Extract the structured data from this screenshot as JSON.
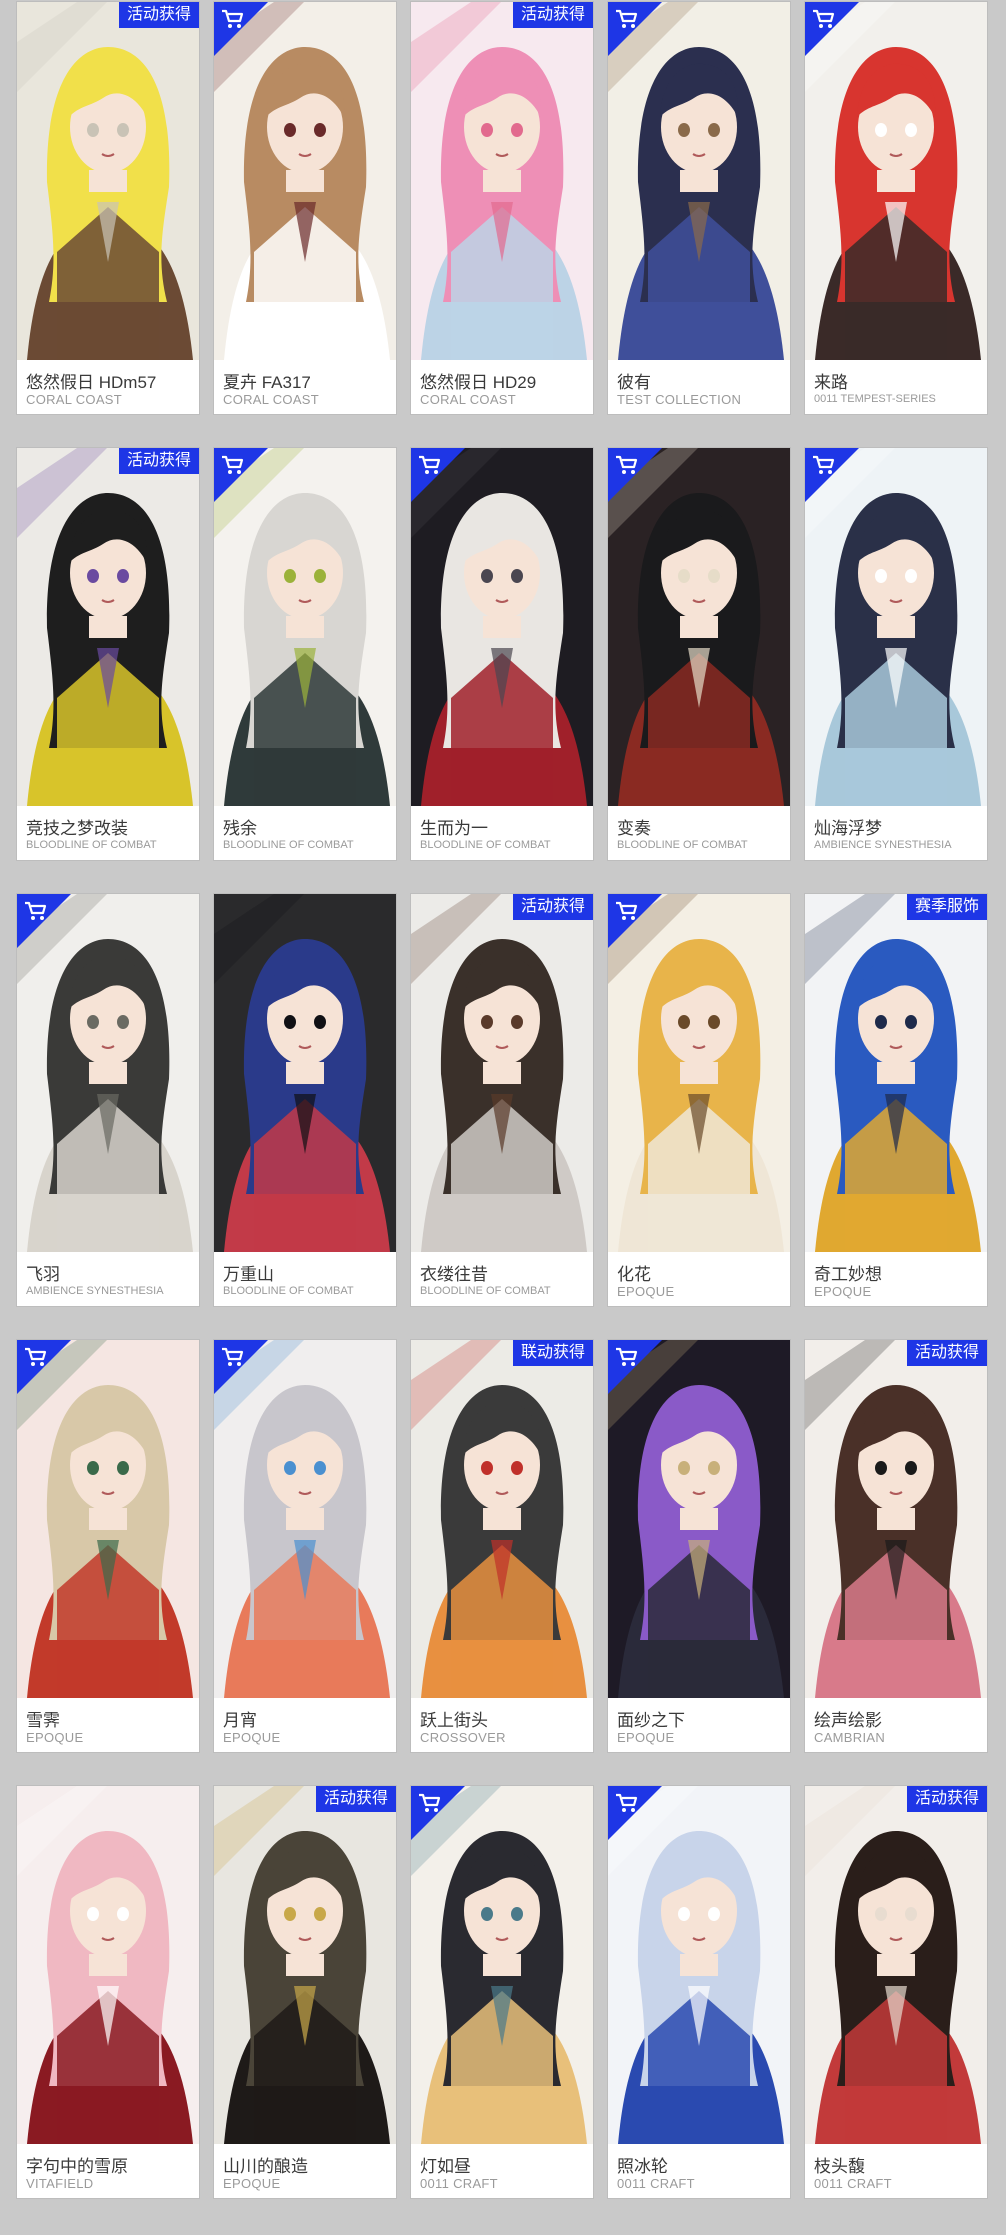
{
  "colors": {
    "accent_blue": "#1e36e6",
    "page_bg": "#c9c9c9",
    "name_text": "#3a3a3a",
    "series_text": "#9a9a9a"
  },
  "cards": [
    {
      "name": "悠然假日 HDm57",
      "series": "CORAL COAST",
      "badge": "活动获得",
      "corner_icon": null,
      "palette": [
        "#e9e6dc",
        "#f1e04a",
        "#6b4a34",
        "#c9c3b6"
      ]
    },
    {
      "name": "夏卉 FA317",
      "series": "CORAL COAST",
      "badge": null,
      "corner_icon": "shop-cart-icon",
      "palette": [
        "#f3efe8",
        "#b88b62",
        "#ffffff",
        "#6a2a2a"
      ]
    },
    {
      "name": "悠然假日 HD29",
      "series": "CORAL COAST",
      "badge": "活动获得",
      "corner_icon": null,
      "palette": [
        "#f7e9ef",
        "#ee8fb6",
        "#bcd3e6",
        "#e26a8e"
      ]
    },
    {
      "name": "彼有",
      "series": "TEST COLLECTION",
      "badge": null,
      "corner_icon": "shop-cart-icon",
      "palette": [
        "#f2efe6",
        "#2b2f4f",
        "#3f4f9a",
        "#8a6a4a"
      ]
    },
    {
      "name": "来路",
      "series": "0011 TEMPEST-SERIES",
      "badge": null,
      "corner_icon": "shop-cart-icon",
      "palette": [
        "#f2f0ec",
        "#d8352f",
        "#3a2a28",
        "#ffffff"
      ]
    },
    {
      "name": "竞技之梦改装",
      "series": "BLOODLINE OF COMBAT",
      "badge": "活动获得",
      "corner_icon": null,
      "palette": [
        "#eceae6",
        "#1e1e1e",
        "#d8c42a",
        "#6a4aa0"
      ]
    },
    {
      "name": "残余",
      "series": "BLOODLINE OF COMBAT",
      "badge": null,
      "corner_icon": "shop-cart-icon",
      "palette": [
        "#f4f2ee",
        "#d8d6d2",
        "#2f3a3a",
        "#9bb23a"
      ]
    },
    {
      "name": "生而为一",
      "series": "BLOODLINE OF COMBAT",
      "badge": null,
      "corner_icon": "shop-cart-icon",
      "palette": [
        "#1e1c22",
        "#e9e6e2",
        "#a0202a",
        "#4a4650"
      ]
    },
    {
      "name": "变奏",
      "series": "BLOODLINE OF COMBAT",
      "badge": null,
      "corner_icon": "shop-cart-icon",
      "palette": [
        "#2a2224",
        "#1a1a1c",
        "#8a2a22",
        "#e6dcc8"
      ]
    },
    {
      "name": "灿海浮梦",
      "series": "AMBIENCE SYNESTHESIA",
      "badge": null,
      "corner_icon": "shop-cart-icon",
      "palette": [
        "#eef3f6",
        "#2a3048",
        "#a8c8da",
        "#ffffff"
      ]
    },
    {
      "name": "飞羽",
      "series": "AMBIENCE SYNESTHESIA",
      "badge": null,
      "corner_icon": "shop-cart-icon",
      "palette": [
        "#f0efec",
        "#3a3a38",
        "#d8d4cc",
        "#6a6a62"
      ]
    },
    {
      "name": "万重山",
      "series": "BLOODLINE OF COMBAT",
      "badge": null,
      "corner_icon": null,
      "palette": [
        "#2a2a2c",
        "#2a3a8a",
        "#c23a48",
        "#101014"
      ]
    },
    {
      "name": "衣缕往昔",
      "series": "BLOODLINE OF COMBAT",
      "badge": "活动获得",
      "corner_icon": null,
      "palette": [
        "#ecebe8",
        "#3a302a",
        "#cfcac6",
        "#5a3a2a"
      ]
    },
    {
      "name": "化花",
      "series": "EPOQUE",
      "badge": null,
      "corner_icon": "shop-cart-icon",
      "palette": [
        "#f4efe4",
        "#e8b44a",
        "#efe6d6",
        "#6a4a2a"
      ]
    },
    {
      "name": "奇工妙想",
      "series": "EPOQUE",
      "badge": "赛季服饰",
      "corner_icon": null,
      "palette": [
        "#f2f3f5",
        "#2a5ac0",
        "#e0a830",
        "#1e2a4a"
      ]
    },
    {
      "name": "雪霁",
      "series": "EPOQUE",
      "badge": null,
      "corner_icon": "shop-cart-icon",
      "palette": [
        "#f5e6e2",
        "#d8c8a8",
        "#c23a2a",
        "#3a6a4a"
      ]
    },
    {
      "name": "月宵",
      "series": "EPOQUE",
      "badge": null,
      "corner_icon": "shop-cart-icon",
      "palette": [
        "#f0eeee",
        "#c8c6cc",
        "#e87a5a",
        "#4a90d0"
      ]
    },
    {
      "name": "跃上街头",
      "series": "CROSSOVER",
      "badge": "联动获得",
      "corner_icon": null,
      "palette": [
        "#ecebe6",
        "#3a3a3a",
        "#e89040",
        "#c0302a"
      ]
    },
    {
      "name": "面纱之下",
      "series": "EPOQUE",
      "badge": null,
      "corner_icon": "shop-cart-icon",
      "palette": [
        "#1e1a26",
        "#8a5ac8",
        "#2a2a3a",
        "#c8b07a"
      ]
    },
    {
      "name": "绘声绘影",
      "series": "CAMBRIAN",
      "badge": "活动获得",
      "corner_icon": null,
      "palette": [
        "#f2eeea",
        "#4a3028",
        "#d87a8a",
        "#1a1a1a"
      ]
    },
    {
      "name": "字句中的雪原",
      "series": "VITAFIELD",
      "badge": null,
      "corner_icon": null,
      "palette": [
        "#f6eeee",
        "#f0b8c2",
        "#8a1a22",
        "#ffffff"
      ]
    },
    {
      "name": "山川的酿造",
      "series": "EPOQUE",
      "badge": "活动获得",
      "corner_icon": null,
      "palette": [
        "#e8e6e0",
        "#4a4438",
        "#1e1a18",
        "#c8a84a"
      ]
    },
    {
      "name": "灯如昼",
      "series": "0011 CRAFT",
      "badge": null,
      "corner_icon": "shop-cart-icon",
      "palette": [
        "#f3f0ea",
        "#2a2a30",
        "#e8c07a",
        "#4a7a8a"
      ]
    },
    {
      "name": "照冰轮",
      "series": "0011 CRAFT",
      "badge": null,
      "corner_icon": "shop-cart-icon",
      "palette": [
        "#f2f4f8",
        "#c8d4ea",
        "#2a4ab0",
        "#ffffff"
      ]
    },
    {
      "name": "枝头馥",
      "series": "0011 CRAFT",
      "badge": "活动获得",
      "corner_icon": null,
      "palette": [
        "#f2eeea",
        "#2a1e1a",
        "#c23a3a",
        "#e8dcd0"
      ]
    }
  ]
}
